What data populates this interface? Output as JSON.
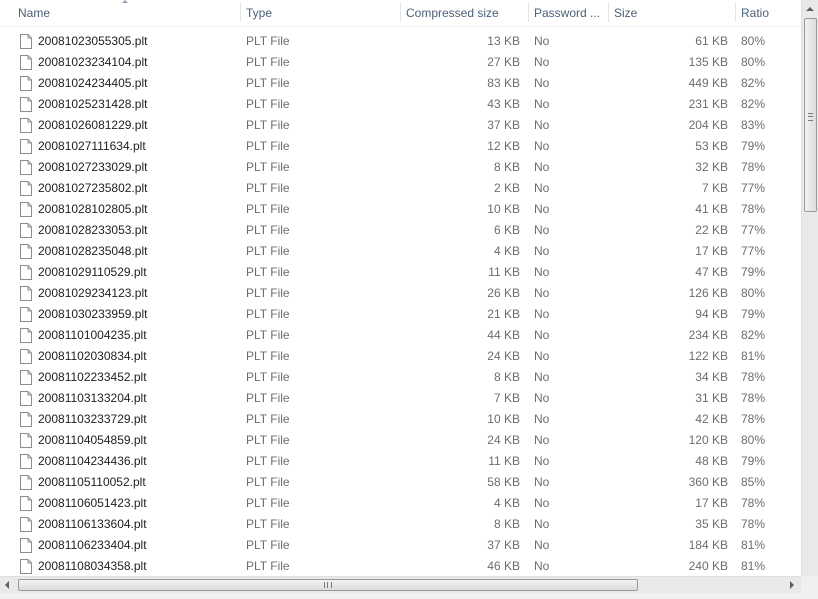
{
  "columns": {
    "name": "Name",
    "type": "Type",
    "compressed": "Compressed size",
    "password": "Password ...",
    "size": "Size",
    "ratio": "Ratio"
  },
  "icons": {
    "file": "file-icon",
    "sort": "sort-ascending-icon"
  },
  "files": [
    {
      "name": "20081023055305.plt",
      "type": "PLT File",
      "compressed": "13 KB",
      "password": "No",
      "size": "61 KB",
      "ratio": "80%"
    },
    {
      "name": "20081023234104.plt",
      "type": "PLT File",
      "compressed": "27 KB",
      "password": "No",
      "size": "135 KB",
      "ratio": "80%"
    },
    {
      "name": "20081024234405.plt",
      "type": "PLT File",
      "compressed": "83 KB",
      "password": "No",
      "size": "449 KB",
      "ratio": "82%"
    },
    {
      "name": "20081025231428.plt",
      "type": "PLT File",
      "compressed": "43 KB",
      "password": "No",
      "size": "231 KB",
      "ratio": "82%"
    },
    {
      "name": "20081026081229.plt",
      "type": "PLT File",
      "compressed": "37 KB",
      "password": "No",
      "size": "204 KB",
      "ratio": "83%"
    },
    {
      "name": "20081027111634.plt",
      "type": "PLT File",
      "compressed": "12 KB",
      "password": "No",
      "size": "53 KB",
      "ratio": "79%"
    },
    {
      "name": "20081027233029.plt",
      "type": "PLT File",
      "compressed": "8 KB",
      "password": "No",
      "size": "32 KB",
      "ratio": "78%"
    },
    {
      "name": "20081027235802.plt",
      "type": "PLT File",
      "compressed": "2 KB",
      "password": "No",
      "size": "7 KB",
      "ratio": "77%"
    },
    {
      "name": "20081028102805.plt",
      "type": "PLT File",
      "compressed": "10 KB",
      "password": "No",
      "size": "41 KB",
      "ratio": "78%"
    },
    {
      "name": "20081028233053.plt",
      "type": "PLT File",
      "compressed": "6 KB",
      "password": "No",
      "size": "22 KB",
      "ratio": "77%"
    },
    {
      "name": "20081028235048.plt",
      "type": "PLT File",
      "compressed": "4 KB",
      "password": "No",
      "size": "17 KB",
      "ratio": "77%"
    },
    {
      "name": "20081029110529.plt",
      "type": "PLT File",
      "compressed": "11 KB",
      "password": "No",
      "size": "47 KB",
      "ratio": "79%"
    },
    {
      "name": "20081029234123.plt",
      "type": "PLT File",
      "compressed": "26 KB",
      "password": "No",
      "size": "126 KB",
      "ratio": "80%"
    },
    {
      "name": "20081030233959.plt",
      "type": "PLT File",
      "compressed": "21 KB",
      "password": "No",
      "size": "94 KB",
      "ratio": "79%"
    },
    {
      "name": "20081101004235.plt",
      "type": "PLT File",
      "compressed": "44 KB",
      "password": "No",
      "size": "234 KB",
      "ratio": "82%"
    },
    {
      "name": "20081102030834.plt",
      "type": "PLT File",
      "compressed": "24 KB",
      "password": "No",
      "size": "122 KB",
      "ratio": "81%"
    },
    {
      "name": "20081102233452.plt",
      "type": "PLT File",
      "compressed": "8 KB",
      "password": "No",
      "size": "34 KB",
      "ratio": "78%"
    },
    {
      "name": "20081103133204.plt",
      "type": "PLT File",
      "compressed": "7 KB",
      "password": "No",
      "size": "31 KB",
      "ratio": "78%"
    },
    {
      "name": "20081103233729.plt",
      "type": "PLT File",
      "compressed": "10 KB",
      "password": "No",
      "size": "42 KB",
      "ratio": "78%"
    },
    {
      "name": "20081104054859.plt",
      "type": "PLT File",
      "compressed": "24 KB",
      "password": "No",
      "size": "120 KB",
      "ratio": "80%"
    },
    {
      "name": "20081104234436.plt",
      "type": "PLT File",
      "compressed": "11 KB",
      "password": "No",
      "size": "48 KB",
      "ratio": "79%"
    },
    {
      "name": "20081105110052.plt",
      "type": "PLT File",
      "compressed": "58 KB",
      "password": "No",
      "size": "360 KB",
      "ratio": "85%"
    },
    {
      "name": "20081106051423.plt",
      "type": "PLT File",
      "compressed": "4 KB",
      "password": "No",
      "size": "17 KB",
      "ratio": "78%"
    },
    {
      "name": "20081106133604.plt",
      "type": "PLT File",
      "compressed": "8 KB",
      "password": "No",
      "size": "35 KB",
      "ratio": "78%"
    },
    {
      "name": "20081106233404.plt",
      "type": "PLT File",
      "compressed": "37 KB",
      "password": "No",
      "size": "184 KB",
      "ratio": "81%"
    },
    {
      "name": "20081108034358.plt",
      "type": "PLT File",
      "compressed": "46 KB",
      "password": "No",
      "size": "240 KB",
      "ratio": "81%"
    }
  ]
}
